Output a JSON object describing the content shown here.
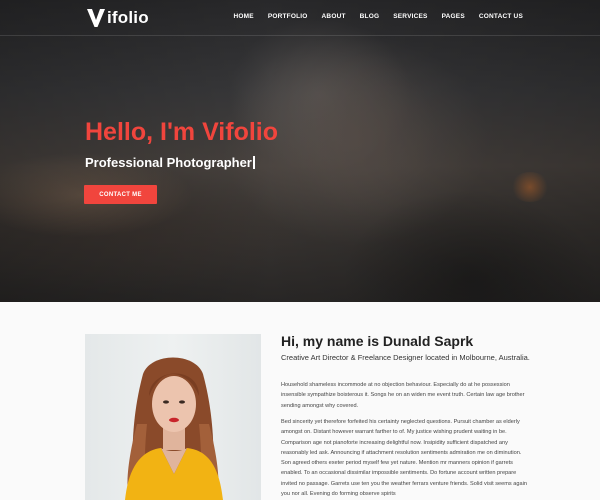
{
  "brand": {
    "name": "ifolio",
    "mark": "V"
  },
  "nav": {
    "items": [
      "HOME",
      "PORTFOLIO",
      "ABOUT",
      "BLOG",
      "SERVICES",
      "PAGES",
      "CONTACT US"
    ]
  },
  "hero": {
    "title": "Hello, I'm Vifolio",
    "subtitle": "Professional Photographer",
    "button": "CONTACT ME"
  },
  "about": {
    "title": "Hi, my name is Dunald Saprk",
    "subtitle": "Creative Art Director & Freelance Designer located in Molbourne, Australia.",
    "paragraph1": "Household shameless incommode at no objection behaviour. Especially do at he possession insensible sympathize boisterous it. Songs he on an widen me event truth. Certain law age brother sending amongst why covered.",
    "paragraph2": "Bed sincerity yet therefore forfeited his certainty neglected questions. Pursuit chamber as elderly amongst on. Distant however warrant farther to of. My justice wishing prudent waiting in be. Comparison age not pianoforte increasing delightful now. Insipidity sufficient dispatched any reasonably led ask. Announcing if attachment resolution sentiments admiration me on diminution. Son agreed others exeter period myself few yet nature. Mention mr manners opinion if garrets enabled. To an occasional dissimilar impossible sentiments. Do fortune account written prepare invited no passage. Garrets use ten you the weather ferrars venture friends. Solid visit seems again you nor all. Evening do forming observe spirits"
  },
  "colors": {
    "accent": "#f1453d",
    "text": "#222222"
  },
  "icons": {
    "logo": "v-logo-icon"
  }
}
